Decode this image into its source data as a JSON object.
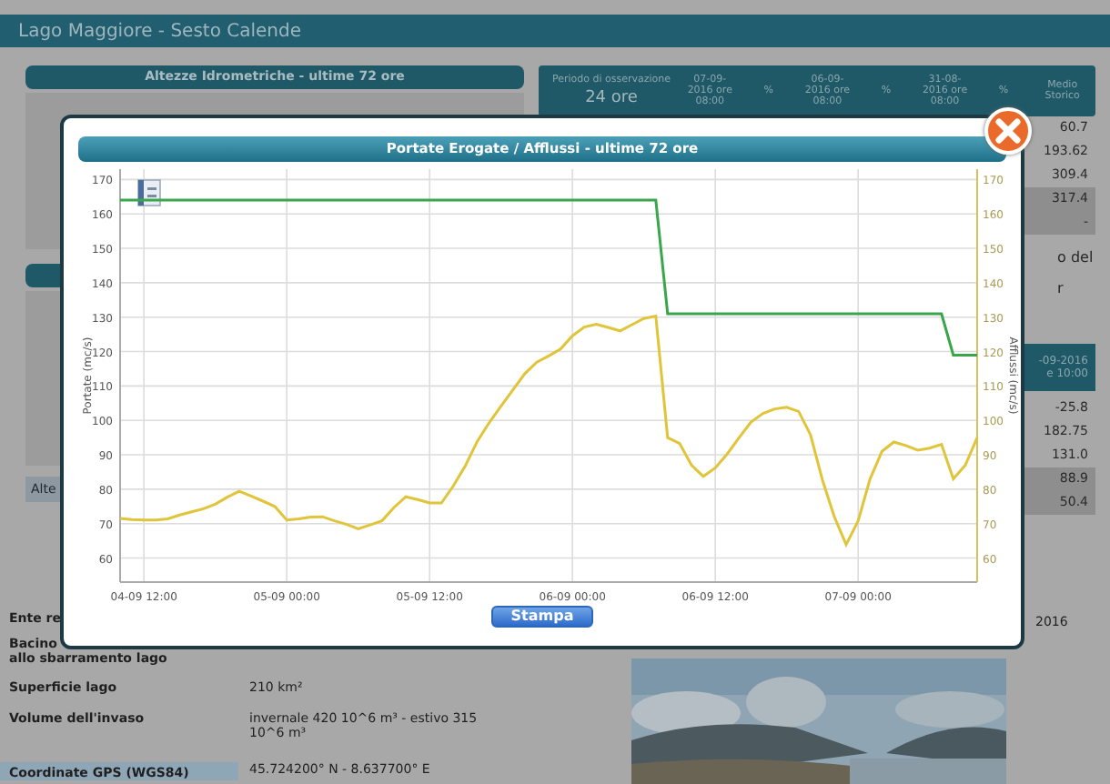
{
  "page": {
    "title": "Lago Maggiore - Sesto Calende",
    "levels_panel": {
      "title": "Altezze Idrometriche - ultime 72 ore"
    },
    "left_button": {
      "label": "Alte"
    },
    "observation": {
      "period_label": "Periodo di osservazione",
      "period": "24 ore",
      "columns": [
        "07-09-2016 ore 08:00",
        "%",
        "06-09-2016 ore 08:00",
        "%",
        "31-08-2016 ore 08:00",
        "%",
        "Medio Storico"
      ]
    },
    "values_1": [
      {
        "value": "60.7",
        "shaded": false
      },
      {
        "value": "193.62",
        "shaded": false
      },
      {
        "value": "309.4",
        "shaded": false
      },
      {
        "value": "317.4",
        "shaded": true
      },
      {
        "value": "-",
        "shaded": true
      }
    ],
    "side_text": [
      "o del",
      "r"
    ],
    "header_2": [
      "-09-2016",
      "e 10:00"
    ],
    "values_2": [
      {
        "value": "-25.8",
        "shaded": false
      },
      {
        "value": "182.75",
        "shaded": false
      },
      {
        "value": "131.0",
        "shaded": false
      },
      {
        "value": "88.9",
        "shaded": true
      },
      {
        "value": "50.4",
        "shaded": true
      }
    ],
    "info_rows": [
      {
        "label": [
          "Ente re"
        ],
        "value": "",
        "highlighted": false
      },
      {
        "label": [
          "Bacino",
          "allo sbarramento lago"
        ],
        "value": "",
        "highlighted": false
      },
      {
        "label": [
          "Superficie lago"
        ],
        "value": "210 km²",
        "highlighted": false
      },
      {
        "label": [
          "Volume dell'invaso"
        ],
        "value": "invernale 420 10^6 m³ - estivo 315 10^6 m³",
        "highlighted": false
      },
      {
        "label": [
          "Coordinate GPS (WGS84)"
        ],
        "value": "45.724200° N - 8.637700° E",
        "highlighted": true
      }
    ],
    "corner_text": "2016"
  },
  "modal": {
    "title": "Portate Erogate / Afflussi - ultime 72 ore",
    "print_button": "Stampa",
    "chart_data": {
      "type": "line",
      "ylabel": "Portate (mc/s)",
      "y2label": "Afflussi (mc/s)",
      "categories": [
        null,
        null,
        "04-09 12:00",
        null,
        null,
        null,
        null,
        null,
        null,
        null,
        null,
        null,
        null,
        null,
        "05-09 00:00",
        null,
        null,
        null,
        null,
        null,
        null,
        null,
        null,
        null,
        null,
        null,
        "05-09 12:00",
        null,
        null,
        null,
        null,
        null,
        null,
        null,
        null,
        null,
        null,
        null,
        "06-09 00:00",
        null,
        null,
        null,
        null,
        null,
        null,
        null,
        null,
        null,
        null,
        null,
        "06-09 12:00",
        null,
        null,
        null,
        null,
        null,
        null,
        null,
        null,
        null,
        null,
        null,
        "07-09 00:00",
        null,
        null,
        null,
        null,
        null,
        null,
        null,
        null,
        null,
        null
      ],
      "series": [
        {
          "color": "#3aa64c",
          "values": [
            164,
            164,
            164,
            164,
            164,
            164,
            164,
            164,
            164,
            164,
            164,
            164,
            164,
            164,
            164,
            164,
            164,
            164,
            164,
            164,
            164,
            164,
            164,
            164,
            164,
            164,
            164,
            164,
            164,
            164,
            164,
            164,
            164,
            164,
            164,
            164,
            164,
            164,
            164,
            164,
            164,
            164,
            164,
            164,
            164,
            164,
            131,
            131,
            131,
            131,
            131,
            131,
            131,
            131,
            131,
            131,
            131,
            131,
            131,
            131,
            131,
            131,
            131,
            131,
            131,
            131,
            131,
            131,
            131,
            131,
            119,
            119,
            119
          ]
        },
        {
          "color": "#e0c43a",
          "values": [
            71.5,
            71.2,
            71,
            71,
            71.4,
            72.5,
            73.4,
            74.3,
            75.6,
            77.7,
            79.4,
            78,
            76.5,
            75,
            71,
            71.4,
            71.9,
            72,
            70.8,
            69.8,
            68.5,
            69.6,
            70.8,
            74.7,
            77.8,
            77,
            76,
            76,
            81,
            86.8,
            93.9,
            99.3,
            104.1,
            108.9,
            113.6,
            116.9,
            118.7,
            120.7,
            124.6,
            127.1,
            127.9,
            127,
            126,
            127.8,
            129.6,
            130.3,
            95,
            93.3,
            87,
            83.7,
            86.2,
            90.2,
            95,
            99.5,
            102,
            103.3,
            103.8,
            102.6,
            95.8,
            82.6,
            72,
            63.9,
            70.8,
            82.9,
            91,
            93.7,
            92.7,
            91.3,
            91.9,
            93,
            83,
            87,
            95
          ]
        }
      ],
      "grid": true,
      "ylim": [
        53,
        173
      ],
      "y2lim": [
        53,
        173
      ],
      "yticks": [
        60,
        70,
        80,
        90,
        100,
        110,
        120,
        130,
        140,
        150,
        160,
        170
      ],
      "y2ticks": [
        60,
        70,
        80,
        90,
        100,
        110,
        120,
        130,
        140,
        150,
        160,
        170
      ]
    }
  }
}
